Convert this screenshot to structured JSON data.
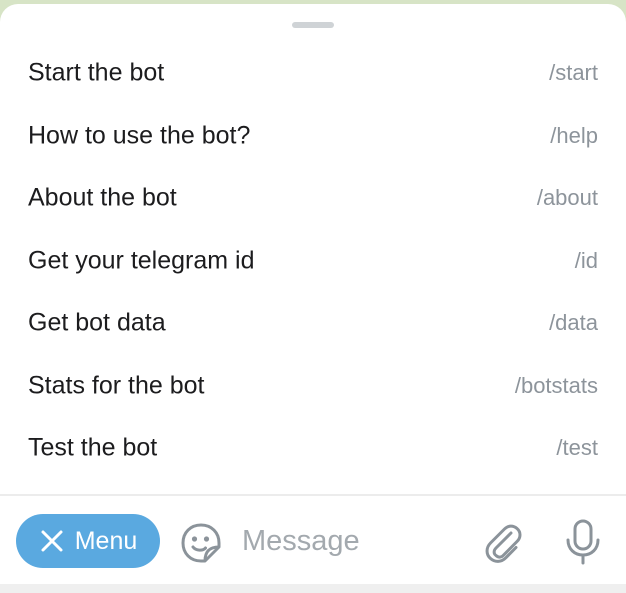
{
  "commands": [
    {
      "description": "Start the bot",
      "command": "/start"
    },
    {
      "description": "How to use the bot?",
      "command": "/help"
    },
    {
      "description": "About the bot",
      "command": "/about"
    },
    {
      "description": "Get your telegram id",
      "command": "/id"
    },
    {
      "description": "Get bot data",
      "command": "/data"
    },
    {
      "description": "Stats for the bot",
      "command": "/botstats"
    },
    {
      "description": "Test the bot",
      "command": "/test"
    }
  ],
  "composer": {
    "menu_label": "Menu",
    "message_placeholder": "Message"
  },
  "icons": {
    "menu_close": "close-icon",
    "sticker": "sticker-icon",
    "attach": "paperclip-icon",
    "mic": "microphone-icon"
  },
  "colors": {
    "accent": "#5aa9e0",
    "icon": "#8b939a",
    "command_text": "#8d949b",
    "primary_text": "#1c1c1e",
    "chat_background": "#d7e4c6"
  }
}
